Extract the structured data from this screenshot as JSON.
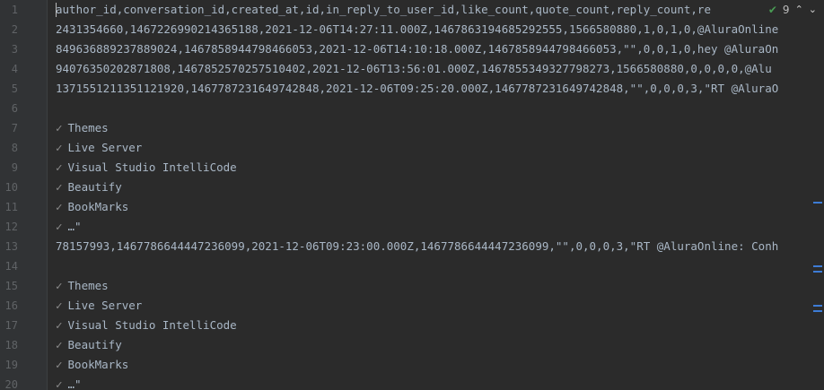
{
  "inspection": {
    "count": "9",
    "status_icon": "check-icon",
    "up_icon": "chevron-up-icon",
    "down_icon": "chevron-down-icon"
  },
  "lines": [
    {
      "n": "1",
      "text": "author_id,conversation_id,created_at,id,in_reply_to_user_id,like_count,quote_count,reply_count,re"
    },
    {
      "n": "2",
      "text": "2431354660,1467226990214365188,2021-12-06T14:27:11.000Z,1467863194685292555,1566580880,1,0,1,0,@AluraOnline"
    },
    {
      "n": "3",
      "text": "849636889237889024,1467858944798466053,2021-12-06T14:10:18.000Z,1467858944798466053,\"\",0,0,1,0,hey @AluraOn"
    },
    {
      "n": "4",
      "text": "940763502028718​08,1467852570257510402,2021-12-06T13:56:01.000Z,1467855349327798273,1566580880,0,0,0,0,@Alu"
    },
    {
      "n": "5",
      "text": "1371551211351121920,1467787231649742848,2021-12-06T09:25:20.000Z,1467787231649742848,\"\",0,0,0,3,\"RT @AluraO"
    },
    {
      "n": "6",
      "text": ""
    },
    {
      "n": "7",
      "text": "Themes"
    },
    {
      "n": "8",
      "text": "Live Server"
    },
    {
      "n": "9",
      "text": "Visual Studio IntelliCode"
    },
    {
      "n": "10",
      "text": "Beautify"
    },
    {
      "n": "11",
      "text": "BookMarks"
    },
    {
      "n": "12",
      "text": "…\""
    },
    {
      "n": "13",
      "text": "78157993,1467786644447236099,2021-12-06T09:23:00.000Z,1467786644447236099,\"\",0,0,0,3,\"RT @AluraOnline: Conh"
    },
    {
      "n": "14",
      "text": ""
    },
    {
      "n": "15",
      "text": "Themes"
    },
    {
      "n": "16",
      "text": "Live Server"
    },
    {
      "n": "17",
      "text": "Visual Studio IntelliCode"
    },
    {
      "n": "18",
      "text": "Beautify"
    },
    {
      "n": "19",
      "text": "BookMarks"
    },
    {
      "n": "20",
      "text": "…\""
    }
  ],
  "check_glyph": "✅"
}
